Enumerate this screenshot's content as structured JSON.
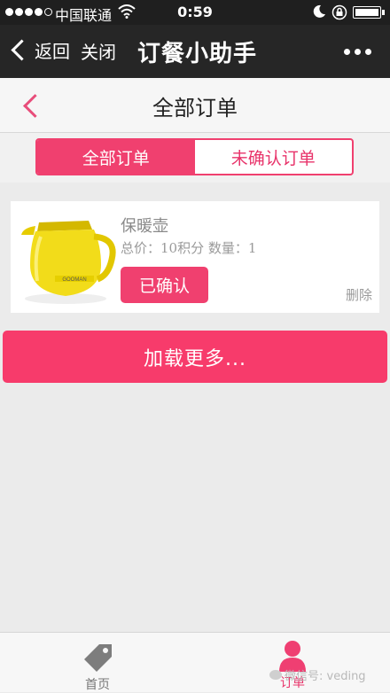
{
  "status_bar": {
    "carrier": "中国联通",
    "time": "0:59"
  },
  "wechat_nav": {
    "back_label": "返回",
    "close_label": "关闭",
    "title": "订餐小助手"
  },
  "page": {
    "title": "全部订单"
  },
  "tabs": [
    {
      "label": "全部订单",
      "active": true
    },
    {
      "label": "未确认订单",
      "active": false
    }
  ],
  "orders": [
    {
      "name": "保暖壶",
      "meta": "总价：10积分 数量：1",
      "status": "已确认",
      "delete_label": "删除",
      "brand": "GOOMAN"
    }
  ],
  "load_more_label": "加载更多...",
  "bottom_nav": [
    {
      "label": "首页",
      "icon": "tag-icon"
    },
    {
      "label": "订单",
      "icon": "person-icon"
    }
  ],
  "watermark": "微信号: veding",
  "colors": {
    "accent": "#f0406f",
    "nav_bg": "#262626"
  }
}
